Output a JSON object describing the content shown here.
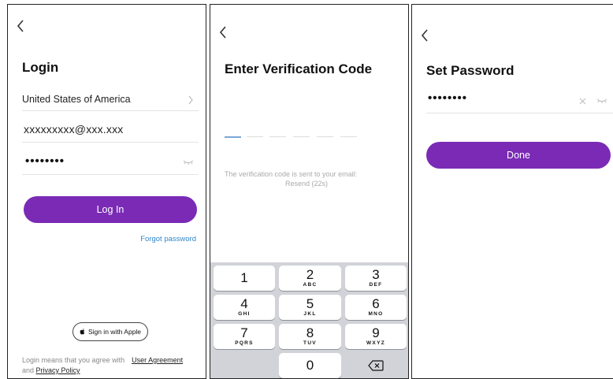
{
  "login": {
    "title": "Login",
    "country": "United States of America",
    "email": "xxxxxxxxx@xxx.xxx",
    "password_mask": "••••••••",
    "login_button": "Log In",
    "forgot_password": "Forgot password",
    "sign_in_apple": "Sign in with Apple",
    "agreement_prefix": "Login means that you agree with",
    "user_agreement": "User Agreement",
    "and": "and",
    "privacy_policy": "Privacy Policy"
  },
  "verify": {
    "title": "Enter Verification Code",
    "info_line1": "The verification code is sent to your email:",
    "resend": "Resend (22s)",
    "keys": [
      {
        "num": "1",
        "letters": ""
      },
      {
        "num": "2",
        "letters": "ABC"
      },
      {
        "num": "3",
        "letters": "DEF"
      },
      {
        "num": "4",
        "letters": "GHI"
      },
      {
        "num": "5",
        "letters": "JKL"
      },
      {
        "num": "6",
        "letters": "MNO"
      },
      {
        "num": "7",
        "letters": "PQRS"
      },
      {
        "num": "8",
        "letters": "TUV"
      },
      {
        "num": "9",
        "letters": "WXYZ"
      },
      {
        "num": "0",
        "letters": ""
      }
    ]
  },
  "set_password": {
    "title": "Set Password",
    "password_mask": "••••••••",
    "done_button": "Done"
  },
  "colors": {
    "accent": "#7a2ab5",
    "link": "#2f87c8"
  },
  "icons": [
    "back-chevron-icon",
    "chevron-right-icon",
    "eye-hidden-icon",
    "apple-logo-icon",
    "backspace-icon",
    "clear-icon"
  ]
}
